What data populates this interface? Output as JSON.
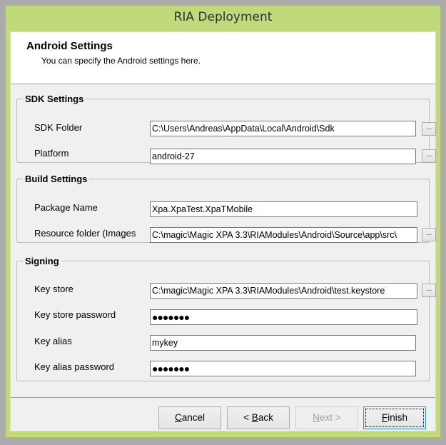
{
  "window": {
    "title": "RIA Deployment"
  },
  "header": {
    "title": "Android Settings",
    "subtitle": "You can specify the Android settings here."
  },
  "sdk": {
    "legend": "SDK Settings",
    "folder_label": "SDK Folder",
    "folder_value": "C:\\Users\\Andreas\\AppData\\Local\\Android\\Sdk",
    "platform_label": "Platform",
    "platform_value": "android-27"
  },
  "build": {
    "legend": "Build Settings",
    "package_label": "Package Name",
    "package_value": "Xpa.XpaTest.XpaTMobile",
    "resource_label": "Resource folder (Images",
    "resource_value": "C:\\magic\\Magic XPA 3.3\\RIAModules\\Android\\Source\\app\\src\\"
  },
  "signing": {
    "legend": "Signing",
    "keystore_label": "Key store",
    "keystore_value": "C:\\magic\\Magic XPA 3.3\\RIAModules\\Android\\test.keystore",
    "keystore_pw_label": "Key store password",
    "keystore_pw_value": "●●●●●●●",
    "alias_label": "Key alias",
    "alias_value": "mykey",
    "alias_pw_label": "Key alias password",
    "alias_pw_value": "●●●●●●●"
  },
  "browse_label": "...",
  "buttons": {
    "cancel": "Cancel",
    "back": "< Back",
    "next": "Next >",
    "finish": "Finish"
  },
  "mnemonics": {
    "cancel": 0,
    "back": 2,
    "next": 0,
    "finish": 0
  }
}
